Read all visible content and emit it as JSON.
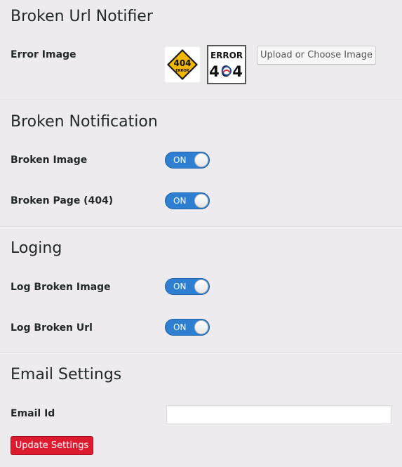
{
  "sections": {
    "broken_url": {
      "title": "Broken Url Notifier",
      "error_image_label": "Error Image",
      "upload_button": "Upload or Choose Image",
      "image1_text_top": "404",
      "image1_text_bottom": "ERROR",
      "image2_text_top": "ERROR",
      "image2_text_bottom": "404"
    },
    "broken_notification": {
      "title": "Broken Notification",
      "broken_image_label": "Broken Image",
      "broken_image_state": "ON",
      "broken_page_label": "Broken Page (404)",
      "broken_page_state": "ON"
    },
    "loging": {
      "title": "Loging",
      "log_broken_image_label": "Log Broken Image",
      "log_broken_image_state": "ON",
      "log_broken_url_label": "Log Broken Url",
      "log_broken_url_state": "ON"
    },
    "email": {
      "title": "Email Settings",
      "email_id_label": "Email Id",
      "email_value": "",
      "update_button": "Update Settings"
    }
  },
  "colors": {
    "background": "#edebed",
    "toggle_on": "#2e7fd2",
    "update_button": "#dc1b2f"
  }
}
